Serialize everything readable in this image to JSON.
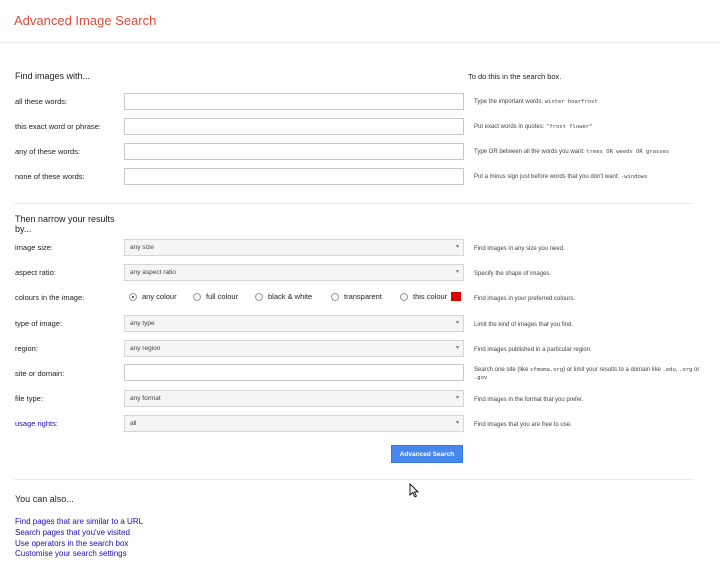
{
  "header": {
    "title": "Advanced Image Search"
  },
  "find_section": {
    "title": "Find images with...",
    "hint_header": "To do this in the search box.",
    "rows": [
      {
        "label": "all these words:",
        "value": "",
        "hint_text": "Type the important words: ",
        "hint_code": "winter hoarfrost"
      },
      {
        "label": "this exact word or phrase:",
        "value": "",
        "hint_text": "Put exact words in quotes: ",
        "hint_code": "\"frost flower\""
      },
      {
        "label": "any of these words:",
        "value": "",
        "hint_text": "Type OR between all the words you want: ",
        "hint_code": "trees OR weeds OR grasses"
      },
      {
        "label": "none of these words:",
        "value": "",
        "hint_text": "Put a minus sign just before words that you don't want: ",
        "hint_code": "-windows"
      }
    ]
  },
  "narrow_section": {
    "title_line1": "Then narrow your results",
    "title_line2": "by...",
    "image_size": {
      "label": "image size:",
      "value": "any size",
      "hint": "Find images in any size you need."
    },
    "aspect_ratio": {
      "label": "aspect ratio:",
      "value": "any aspect ratio",
      "hint": "Specify the shape of images."
    },
    "colours": {
      "label": "colours in the image:",
      "options": [
        "any colour",
        "full colour",
        "black & white",
        "transparent",
        "this colour"
      ],
      "selected": "any colour",
      "swatch_color": "#e00000",
      "hint": "Find images in your preferred colours."
    },
    "type_of_image": {
      "label": "type of image:",
      "value": "any type",
      "hint": "Limit the kind of images that you find."
    },
    "region": {
      "label": "region:",
      "value": "any region",
      "hint": "Find images published in a particular region."
    },
    "site_or_domain": {
      "label": "site or domain:",
      "value": "",
      "hint_a": "Search one site (like ",
      "hint_code1": "sfmoma.org",
      "hint_b": ") or limit your results to a domain like ",
      "hint_code2": ".edu",
      "hint_c": ", ",
      "hint_code3": ".org",
      "hint_d": " or ",
      "hint_code4": ".gov"
    },
    "file_type": {
      "label": "file type:",
      "value": "any format",
      "hint": "Find images in the format that you prefer."
    },
    "usage_rights": {
      "label": "usage rights:",
      "value": "all",
      "hint": "Find images that you are free to use."
    }
  },
  "actions": {
    "search_button": "Advanced Search"
  },
  "also": {
    "title": "You can also...",
    "links": [
      "Find pages that are similar to a URL",
      "Search pages that you've visited",
      "Use operators in the search box",
      "Customise your search settings"
    ]
  },
  "colors": {
    "accent_red": "#dd4b39",
    "button_blue": "#4787ed",
    "link_blue": "#1a0dab"
  }
}
